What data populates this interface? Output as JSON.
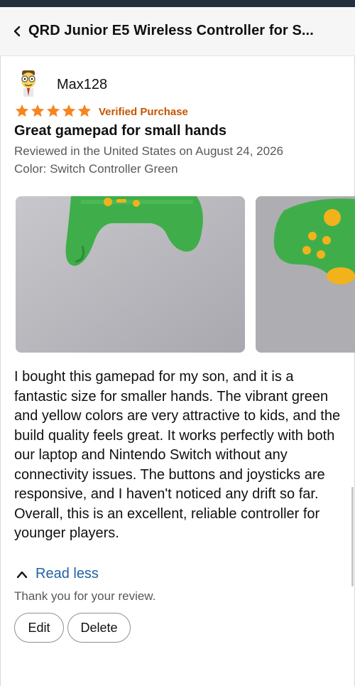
{
  "header": {
    "title": "QRD Junior E5 Wireless Controller for S...",
    "back_icon": "chevron-left-icon"
  },
  "review": {
    "reviewer_name": "Max128",
    "avatar_icon": "cartoon-avatar",
    "rating": 5,
    "rating_max": 5,
    "verified_label": "Verified Purchase",
    "title": "Great gamepad for small hands",
    "date_line": "Reviewed in the United States on August 24, 2026",
    "color_line": "Color: Switch Controller Green",
    "photos": [
      {
        "subject": "green controller with yellow buttons"
      },
      {
        "subject": "green controller with yellow buttons"
      }
    ],
    "body": "I bought this gamepad for my son, and it is a fantastic size for smaller hands. The vibrant green and yellow colors are very attractive to kids, and the build quality feels great. It works perfectly with both our laptop and Nintendo Switch without any connectivity issues. The buttons and joysticks are responsive, and I haven't noticed any drift so far. Overall, this is an excellent, reliable controller for younger players.",
    "read_less_label": "Read less",
    "thanks_text": "Thank you for your review.",
    "edit_label": "Edit",
    "delete_label": "Delete"
  },
  "colors": {
    "star": "#f5861f",
    "verified": "#c45500",
    "link": "#2162a1",
    "controller_green": "#3fae4a",
    "controller_yellow": "#f2b21b"
  }
}
